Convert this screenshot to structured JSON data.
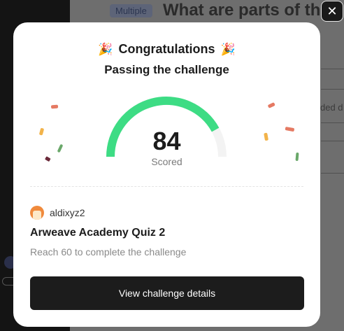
{
  "background": {
    "tag": "Multiple",
    "question": "What are parts of the S",
    "option_fragment": "ded d"
  },
  "modal": {
    "title": "Congratulations",
    "title_icon": "party-popper-icon",
    "subtitle": "Passing the challenge",
    "score": {
      "value": "84",
      "fraction": 0.84,
      "label": "Scored",
      "fill_color": "#3ddc84",
      "track_color": "#f3f3f3"
    },
    "creator": {
      "name": "aldixyz2"
    },
    "quiz_title": "Arweave Academy Quiz 2",
    "requirement": "Reach 60 to complete the challenge",
    "cta_label": "View challenge details"
  },
  "close_icon": "close-icon"
}
